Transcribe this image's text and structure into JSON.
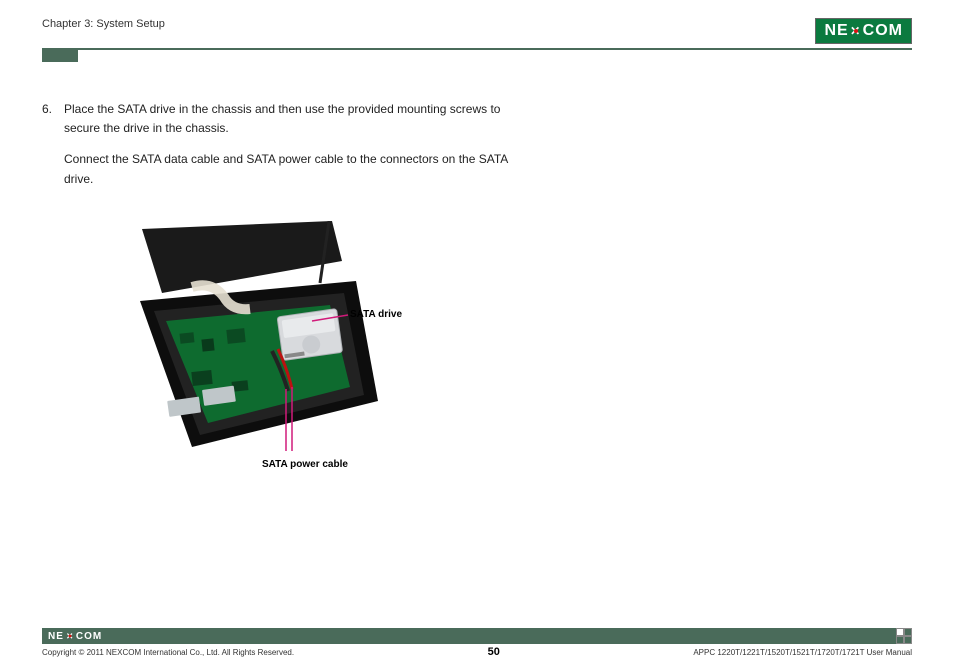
{
  "header": {
    "chapter": "Chapter 3: System Setup",
    "brand_left": "NE",
    "brand_right": "COM"
  },
  "content": {
    "step_number": "6.",
    "step_text_1": "Place the SATA drive in the chassis and then use the provided mounting screws to secure the drive in the chassis.",
    "step_text_2": "Connect the SATA data cable and SATA power cable to the connectors on the SATA drive."
  },
  "figure": {
    "label_drive": "SATA drive",
    "label_power": "SATA power cable"
  },
  "footer": {
    "brand_left": "NE",
    "brand_right": "COM",
    "copyright": "Copyright © 2011 NEXCOM International Co., Ltd. All Rights Reserved.",
    "page_number": "50",
    "manual": "APPC 1220T/1221T/1520T/1521T/1720T/1721T User Manual"
  }
}
